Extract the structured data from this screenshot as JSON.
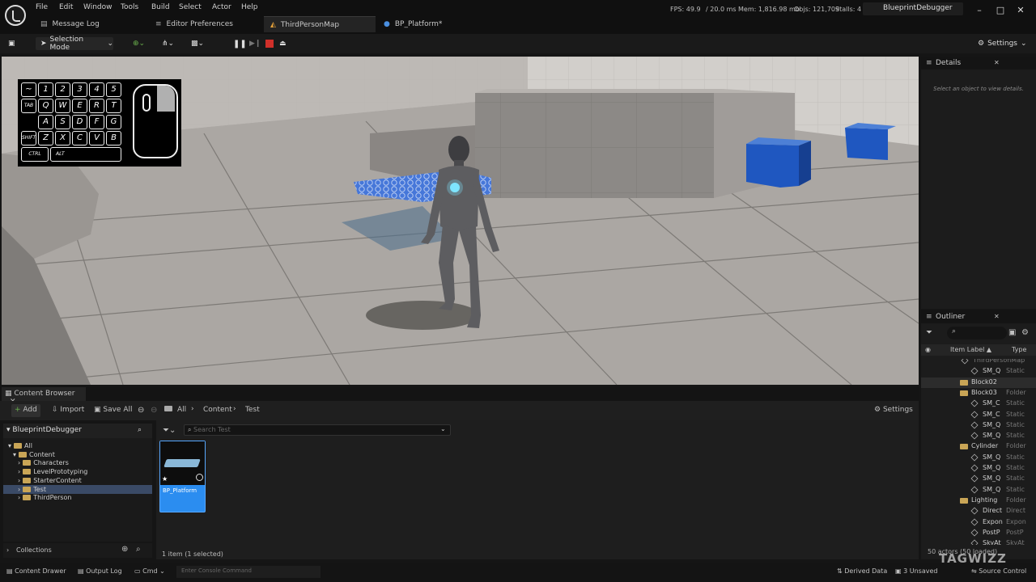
{
  "app": {
    "tabs": [
      {
        "label": "Message Log"
      },
      {
        "label": "Editor Preferences"
      },
      {
        "label": "ThirdPersonMap"
      },
      {
        "label": "BP_Platform*"
      }
    ],
    "menu": [
      "File",
      "Edit",
      "Window",
      "Tools",
      "Build",
      "Select",
      "Actor",
      "Help"
    ],
    "stats": {
      "fps": "FPS: 49.9",
      "ms": "/ 20.0 ms",
      "mem": "Mem: 1,816.98 mb",
      "objs": "Objs: 121,709",
      "stalls": "Stalls: 4"
    },
    "project": "BlueprintDebugger"
  },
  "toolbar": {
    "mode": "Selection Mode",
    "settings": "Settings"
  },
  "keyboard": {
    "rows": [
      [
        "~",
        "1",
        "2",
        "3",
        "4",
        "5"
      ],
      [
        "TAB",
        "Q",
        "W",
        "E",
        "R",
        "T"
      ],
      [
        "A",
        "S",
        "D",
        "F",
        "G"
      ],
      [
        "SHIFT",
        "Z",
        "X",
        "C",
        "V",
        "B"
      ],
      [
        "CTRL",
        "ALT"
      ]
    ]
  },
  "details": {
    "title": "Details",
    "hint": "Select an object to view details."
  },
  "outliner": {
    "title": "Outliner",
    "col_label": "Item Label ▲",
    "col_type": "Type",
    "rows": [
      {
        "label": "ThirdPersonMap",
        "type": ""
      },
      {
        "label": "SM_Q",
        "type": "Static"
      },
      {
        "label": "Block02",
        "type": ""
      },
      {
        "label": "Block03",
        "type": "Folder"
      },
      {
        "label": "SM_C",
        "type": "Static"
      },
      {
        "label": "SM_C",
        "type": "Static"
      },
      {
        "label": "SM_Q",
        "type": "Static"
      },
      {
        "label": "SM_Q",
        "type": "Static"
      },
      {
        "label": "Cylinder",
        "type": "Folder"
      },
      {
        "label": "SM_Q",
        "type": "Static"
      },
      {
        "label": "SM_Q",
        "type": "Static"
      },
      {
        "label": "SM_Q",
        "type": "Static"
      },
      {
        "label": "SM_Q",
        "type": "Static"
      },
      {
        "label": "Lighting",
        "type": "Folder"
      },
      {
        "label": "Direct",
        "type": "Direct"
      },
      {
        "label": "Expon",
        "type": "Expon"
      },
      {
        "label": "PostP",
        "type": "PostP"
      },
      {
        "label": "SkyAt",
        "type": "SkyAt"
      }
    ],
    "footer": "50 actors (50 loaded)"
  },
  "content_browser": {
    "tab": "Content Browser",
    "add": "Add",
    "import": "Import",
    "save_all": "Save All",
    "path": [
      "All",
      "Content",
      "Test"
    ],
    "settings": "Settings",
    "search_placeholder": "Search Test",
    "root": "BlueprintDebugger",
    "tree": [
      "All",
      "Content",
      "Characters",
      "LevelPrototyping",
      "StarterContent",
      "Test",
      "ThirdPerson"
    ],
    "asset": "BP_Platform",
    "collections": "Collections",
    "status": "1 item (1 selected)"
  },
  "statusbar": {
    "drawer": "Content Drawer",
    "output": "Output Log",
    "cmd": "Cmd",
    "console_placeholder": "Enter Console Command",
    "derived": "Derived Data",
    "unsaved": "3 Unsaved",
    "source": "Source Control"
  },
  "watermark": "TAGWIZZ"
}
